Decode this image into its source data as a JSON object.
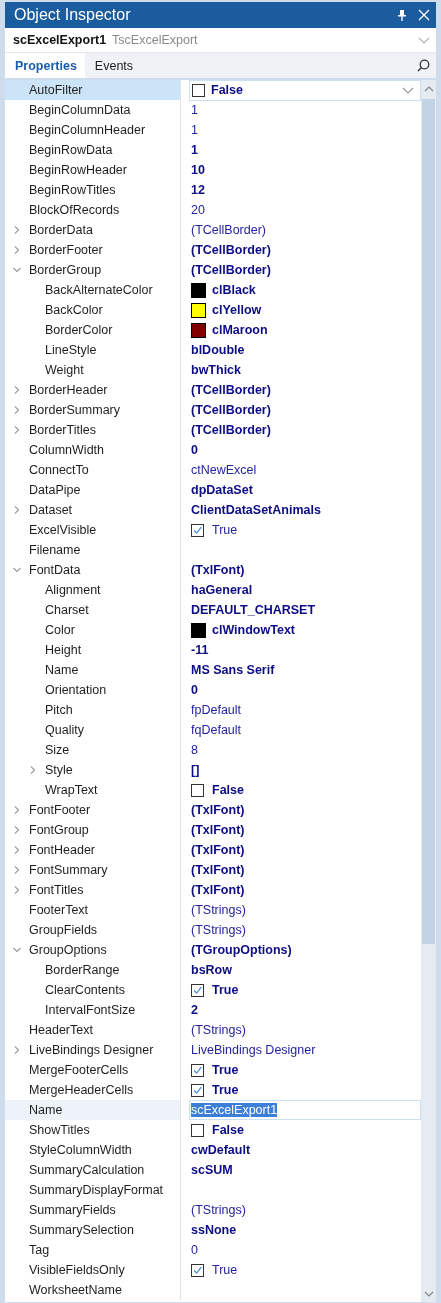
{
  "window": {
    "title": "Object Inspector"
  },
  "object_selector": {
    "name": "scExcelExport1",
    "class": "TscExcelExport"
  },
  "tabs": [
    {
      "label": "Properties",
      "selected": true
    },
    {
      "label": "Events",
      "selected": false
    }
  ],
  "properties": [
    {
      "name": "AutoFilter",
      "selected": true,
      "kind": "check",
      "checked": false,
      "value": "False",
      "modified": true
    },
    {
      "name": "BeginColumnData",
      "selected": false,
      "kind": "text",
      "value": "1",
      "modified": false
    },
    {
      "name": "BeginColumnHeader",
      "selected": false,
      "kind": "text",
      "value": "1",
      "modified": false
    },
    {
      "name": "BeginRowData",
      "selected": false,
      "kind": "text",
      "value": "1",
      "modified": true
    },
    {
      "name": "BeginRowHeader",
      "selected": false,
      "kind": "text",
      "value": "10",
      "modified": true
    },
    {
      "name": "BeginRowTitles",
      "selected": false,
      "kind": "text",
      "value": "12",
      "modified": true
    },
    {
      "name": "BlockOfRecords",
      "selected": false,
      "kind": "text",
      "value": "20",
      "modified": false
    },
    {
      "name": "BorderData",
      "selected": false,
      "kind": "text",
      "value": "(TCellBorder)",
      "modified": false,
      "expanded": false
    },
    {
      "name": "BorderFooter",
      "selected": false,
      "kind": "text",
      "value": "(TCellBorder)",
      "modified": true,
      "expanded": false
    },
    {
      "name": "BorderGroup",
      "selected": false,
      "kind": "text",
      "value": "(TCellBorder)",
      "modified": true,
      "expanded": true,
      "children": [
        {
          "name": "BackAlternateColor",
          "selected": false,
          "kind": "color",
          "color": "#000000",
          "value": "clBlack",
          "modified": true
        },
        {
          "name": "BackColor",
          "selected": false,
          "kind": "color",
          "color": "#ffff00",
          "value": "clYellow",
          "modified": true
        },
        {
          "name": "BorderColor",
          "selected": false,
          "kind": "color",
          "color": "#800000",
          "value": "clMaroon",
          "modified": true
        },
        {
          "name": "LineStyle",
          "selected": false,
          "kind": "text",
          "value": "blDouble",
          "modified": true
        },
        {
          "name": "Weight",
          "selected": false,
          "kind": "text",
          "value": "bwThick",
          "modified": true
        }
      ]
    },
    {
      "name": "BorderHeader",
      "selected": false,
      "kind": "text",
      "value": "(TCellBorder)",
      "modified": true,
      "expanded": false
    },
    {
      "name": "BorderSummary",
      "selected": false,
      "kind": "text",
      "value": "(TCellBorder)",
      "modified": true,
      "expanded": false
    },
    {
      "name": "BorderTitles",
      "selected": false,
      "kind": "text",
      "value": "(TCellBorder)",
      "modified": true,
      "expanded": false
    },
    {
      "name": "ColumnWidth",
      "selected": false,
      "kind": "text",
      "value": "0",
      "modified": true
    },
    {
      "name": "ConnectTo",
      "selected": false,
      "kind": "text",
      "value": "ctNewExcel",
      "modified": false
    },
    {
      "name": "DataPipe",
      "selected": false,
      "kind": "text",
      "value": "dpDataSet",
      "modified": true
    },
    {
      "name": "Dataset",
      "selected": false,
      "kind": "text",
      "value": "ClientDataSetAnimals",
      "modified": true,
      "expanded": false
    },
    {
      "name": "ExcelVisible",
      "selected": false,
      "kind": "check",
      "checked": true,
      "value": "True",
      "modified": false
    },
    {
      "name": "Filename",
      "selected": false,
      "kind": "text"
    },
    {
      "name": "FontData",
      "selected": false,
      "kind": "text",
      "value": "(TxlFont)",
      "modified": true,
      "expanded": true,
      "children": [
        {
          "name": "Alignment",
          "selected": false,
          "kind": "text",
          "value": "haGeneral",
          "modified": true
        },
        {
          "name": "Charset",
          "selected": false,
          "kind": "text",
          "value": "DEFAULT_CHARSET",
          "modified": true
        },
        {
          "name": "Color",
          "selected": false,
          "kind": "color",
          "color": "#000000",
          "value": "clWindowText",
          "modified": true
        },
        {
          "name": "Height",
          "selected": false,
          "kind": "text",
          "value": "-11",
          "modified": true
        },
        {
          "name": "Name",
          "selected": false,
          "kind": "text",
          "value": "MS Sans Serif",
          "modified": true
        },
        {
          "name": "Orientation",
          "selected": false,
          "kind": "text",
          "value": "0",
          "modified": true
        },
        {
          "name": "Pitch",
          "selected": false,
          "kind": "text",
          "value": "fpDefault",
          "modified": false
        },
        {
          "name": "Quality",
          "selected": false,
          "kind": "text",
          "value": "fqDefault",
          "modified": false
        },
        {
          "name": "Size",
          "selected": false,
          "kind": "text",
          "value": "8",
          "modified": false
        },
        {
          "name": "Style",
          "selected": false,
          "kind": "text",
          "value": "[]",
          "modified": true,
          "expanded": false
        },
        {
          "name": "WrapText",
          "selected": false,
          "kind": "check",
          "checked": false,
          "value": "False",
          "modified": true
        }
      ]
    },
    {
      "name": "FontFooter",
      "selected": false,
      "kind": "text",
      "value": "(TxlFont)",
      "modified": true,
      "expanded": false
    },
    {
      "name": "FontGroup",
      "selected": false,
      "kind": "text",
      "value": "(TxlFont)",
      "modified": true,
      "expanded": false
    },
    {
      "name": "FontHeader",
      "selected": false,
      "kind": "text",
      "value": "(TxlFont)",
      "modified": true,
      "expanded": false
    },
    {
      "name": "FontSummary",
      "selected": false,
      "kind": "text",
      "value": "(TxlFont)",
      "modified": true,
      "expanded": false
    },
    {
      "name": "FontTitles",
      "selected": false,
      "kind": "text",
      "value": "(TxlFont)",
      "modified": true,
      "expanded": false
    },
    {
      "name": "FooterText",
      "selected": false,
      "kind": "text",
      "value": "(TStrings)",
      "modified": false
    },
    {
      "name": "GroupFields",
      "selected": false,
      "kind": "text",
      "value": "(TStrings)",
      "modified": false
    },
    {
      "name": "GroupOptions",
      "selected": false,
      "kind": "text",
      "value": "(TGroupOptions)",
      "modified": true,
      "expanded": true,
      "children": [
        {
          "name": "BorderRange",
          "selected": false,
          "kind": "text",
          "value": "bsRow",
          "modified": true
        },
        {
          "name": "ClearContents",
          "selected": false,
          "kind": "check",
          "checked": true,
          "value": "True",
          "modified": true
        },
        {
          "name": "IntervalFontSize",
          "selected": false,
          "kind": "text",
          "value": "2",
          "modified": true
        }
      ]
    },
    {
      "name": "HeaderText",
      "selected": false,
      "kind": "text",
      "value": "(TStrings)",
      "modified": false
    },
    {
      "name": "LiveBindings Designer",
      "selected": false,
      "kind": "text",
      "value": "LiveBindings Designer",
      "modified": false,
      "expanded": false
    },
    {
      "name": "MergeFooterCells",
      "selected": false,
      "kind": "check",
      "checked": true,
      "value": "True",
      "modified": true
    },
    {
      "name": "MergeHeaderCells",
      "selected": false,
      "kind": "check",
      "checked": true,
      "value": "True",
      "modified": true
    },
    {
      "name": "Name",
      "selected": false,
      "kind": "edit",
      "value": "scExcelExport1",
      "modified": false
    },
    {
      "name": "ShowTitles",
      "selected": false,
      "kind": "check",
      "checked": false,
      "value": "False",
      "modified": true
    },
    {
      "name": "StyleColumnWidth",
      "selected": false,
      "kind": "text",
      "value": "cwDefault",
      "modified": true
    },
    {
      "name": "SummaryCalculation",
      "selected": false,
      "kind": "text",
      "value": "scSUM",
      "modified": true
    },
    {
      "name": "SummaryDisplayFormat",
      "selected": false,
      "kind": "text"
    },
    {
      "name": "SummaryFields",
      "selected": false,
      "kind": "text",
      "value": "(TStrings)",
      "modified": false
    },
    {
      "name": "SummarySelection",
      "selected": false,
      "kind": "text",
      "value": "ssNone",
      "modified": true
    },
    {
      "name": "Tag",
      "selected": false,
      "kind": "text",
      "value": "0",
      "modified": false
    },
    {
      "name": "VisibleFieldsOnly",
      "selected": false,
      "kind": "check",
      "checked": true,
      "value": "True",
      "modified": false
    },
    {
      "name": "WorksheetName",
      "selected": false,
      "kind": "text"
    }
  ]
}
